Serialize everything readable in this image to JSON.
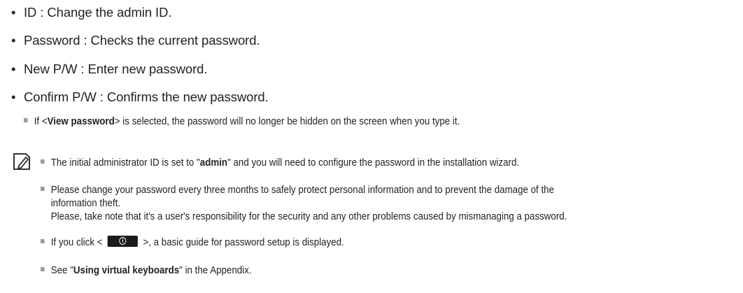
{
  "bullets": [
    "ID : Change the admin ID.",
    "Password : Checks the current password.",
    "New P/W : Enter new password.",
    "Confirm P/W : Confirms the new password."
  ],
  "subnote": {
    "prefix": "If <",
    "bold": "View password",
    "suffix": "> is selected, the password will no longer be hidden on the screen when you type it."
  },
  "notes": {
    "n1_prefix": "The initial administrator ID is set to \"",
    "n1_bold": "admin",
    "n1_suffix": "\" and you will need to configure the password in the installation wizard.",
    "n2_line1": "Please change your password every three months to safely protect personal information and to prevent the damage of the",
    "n2_line2": "information theft.",
    "n2_line3": "Please, take note that it's a user's responsibility for the security and any other problems caused by mismanaging a password.",
    "n3_prefix": "If you click <",
    "n3_suffix": ">, a basic guide for password setup is displayed.",
    "n3_button_icon": "info-icon",
    "n4_prefix": "See \"",
    "n4_bold": "Using virtual keyboards",
    "n4_suffix": "\" in the Appendix."
  },
  "icons": {
    "note": "note-pencil-icon",
    "bullet_square": "square-bullet-icon"
  },
  "colors": {
    "text": "#222222",
    "square_bullet": "#9a9a9a",
    "button_bg": "#1b1b1b"
  }
}
